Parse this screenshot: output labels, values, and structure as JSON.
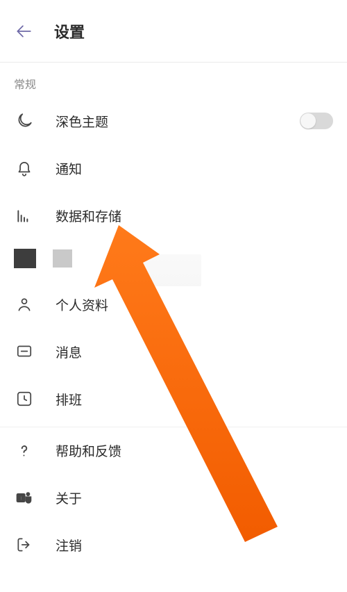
{
  "header": {
    "title": "设置"
  },
  "section_general_label": "常规",
  "items": {
    "dark_theme": "深色主题",
    "notifications": "通知",
    "data_storage": "数据和存储",
    "profile": "个人资料",
    "messages": "消息",
    "shifts": "排班",
    "help_feedback": "帮助和反馈",
    "about": "关于",
    "sign_out": "注销"
  },
  "dark_theme_on": false
}
